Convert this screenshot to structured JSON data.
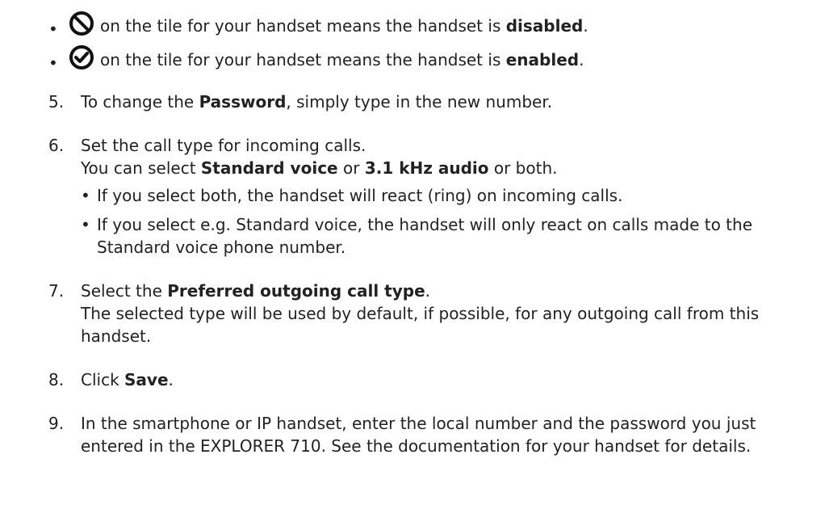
{
  "bullets_top": [
    {
      "text_a": "on the tile for your handset means the handset is ",
      "bold": "disabled",
      "text_b": ".",
      "icon": "prohibited-circle-icon"
    },
    {
      "text_a": "on the tile for your handset means the handset is ",
      "bold": "enabled",
      "text_b": ".",
      "icon": "check-circle-icon"
    }
  ],
  "steps": {
    "s5": {
      "num": "5.",
      "a": "To change the ",
      "b": "Password",
      "c": ", simply type in the new number."
    },
    "s6": {
      "num": "6.",
      "line1": "Set the call type for incoming calls.",
      "l2a": "You can select ",
      "l2b": "Standard voice",
      "l2c": " or ",
      "l2d": "3.1 kHz audio",
      "l2e": " or both.",
      "bullet1": "If you select both, the handset will react (ring) on incoming calls.",
      "bullet2a": "If you select e.g. Standard voice, the handset will only react on calls made to the",
      "bullet2b": "Standard voice phone number."
    },
    "s7": {
      "num": "7.",
      "a": "Select the ",
      "b": "Preferred outgoing call type",
      "c": ".",
      "line2": "The selected type will be used by default, if possible, for any outgoing call from this",
      "line3": "handset."
    },
    "s8": {
      "num": "8.",
      "a": "Click ",
      "b": "Save",
      "c": "."
    },
    "s9": {
      "num": "9.",
      "line1": "In the smartphone or IP handset, enter the local number and the password you just",
      "line2": "entered in the EXPLORER 710. See the documentation for your handset for details."
    }
  }
}
